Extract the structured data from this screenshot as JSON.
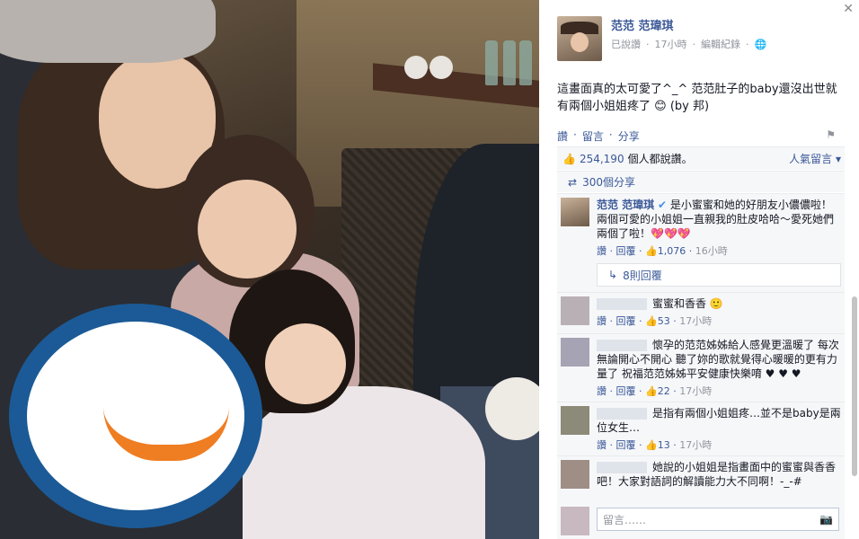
{
  "photo": {
    "alt": ""
  },
  "post": {
    "author": "范范 范瑋琪",
    "status": "已說讚",
    "time": "17小時",
    "edit": "編輯紀錄",
    "text": "這畫面真的太可愛了^_^ 范范肚子的baby還沒出世就有兩個小姐姐疼了 😊 (by 邦)"
  },
  "actions": {
    "like": "讚",
    "comment": "留言",
    "share": "分享",
    "sep": "·"
  },
  "likes": {
    "count": "254,190",
    "suffix": "個人都說讚。",
    "sort": "人氣留言"
  },
  "shares": {
    "label": "300個分享"
  },
  "comments": [
    {
      "author": "范范 范瑋琪",
      "text": "是小蜜蜜和她的好朋友小儂儂啦！兩個可愛的小姐姐一直親我的肚皮哈哈～愛死她們兩個了啦！💖💖💖",
      "like": "讚",
      "reply": "回覆",
      "likes": "1,076",
      "time": "16小時",
      "replies": "8則回覆"
    },
    {
      "text": "蜜蜜和香香 🙂",
      "like": "讚",
      "reply": "回覆",
      "likes": "53",
      "time": "17小時"
    },
    {
      "text": "懷孕的范范姊姊給人感覺更溫暖了 每次無論開心不開心 聽了妳的歌就覺得心暖暖的更有力量了 祝福范范姊姊平安健康快樂唷 ♥ ♥ ♥",
      "like": "讚",
      "reply": "回覆",
      "likes": "22",
      "time": "17小時"
    },
    {
      "text": "是指有兩個小姐姐疼…並不是baby是兩位女生…",
      "like": "讚",
      "reply": "回覆",
      "likes": "13",
      "time": "17小時"
    },
    {
      "text": "她說的小姐姐是指畫面中的蜜蜜與香香吧！大家對語詞的解讀能力大不同啊！-_-#"
    }
  ],
  "input": {
    "placeholder": "留言……"
  },
  "icons": {
    "close": "close-icon",
    "globe": "globe-icon",
    "flag": "flag-icon",
    "thumb": "thumbs-up-icon",
    "share": "share-icon",
    "camera": "camera-icon",
    "verified": "verified-icon",
    "reply": "reply-icon"
  },
  "colors": {
    "link": "#3b5998",
    "meta": "#90949c",
    "panel_bg": "#f6f7f9"
  }
}
